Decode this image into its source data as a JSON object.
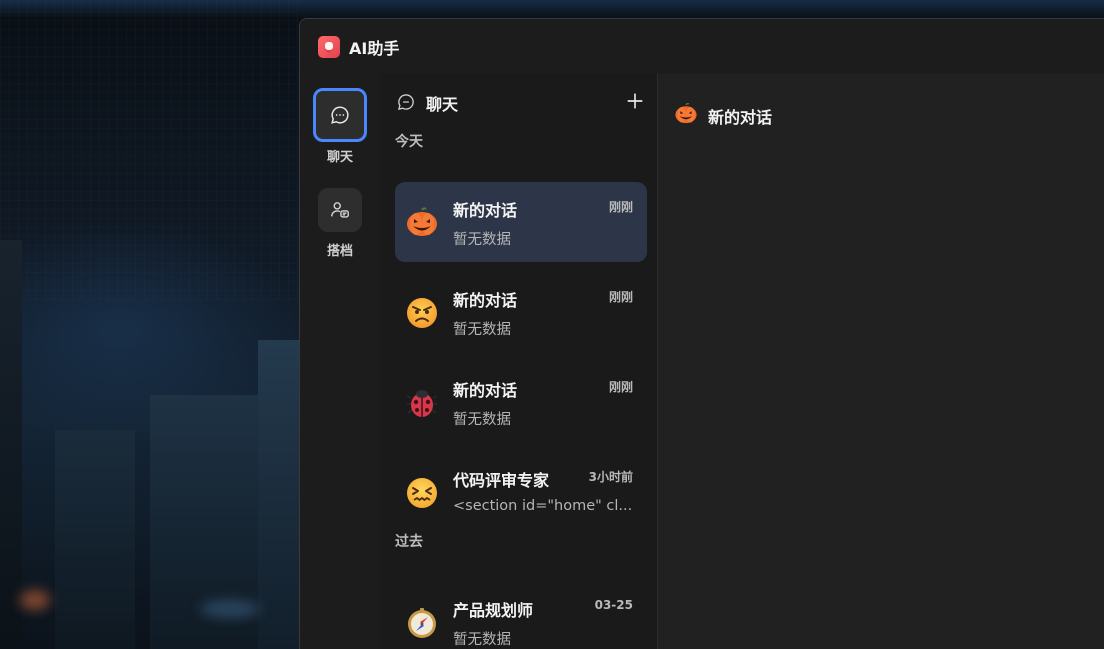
{
  "app": {
    "title": "AI助手",
    "brand_color": "#e0424d",
    "accent_color": "#4a87ff"
  },
  "rail": {
    "items": [
      {
        "label": "聊天",
        "icon": "chat-bubble-icon",
        "active": true
      },
      {
        "label": "搭档",
        "icon": "partner-icon",
        "active": false
      }
    ]
  },
  "sessions": {
    "header_title": "聊天",
    "header_icon": "chat-bubble-icon",
    "new_button_icon": "plus-icon",
    "groups": [
      {
        "label": "今天"
      },
      {
        "label": "过去"
      }
    ],
    "items": [
      {
        "title": "新的对话",
        "time": "刚刚",
        "preview": "暂无数据",
        "emoji": "pumpkin-icon",
        "selected": true
      },
      {
        "title": "新的对话",
        "time": "刚刚",
        "preview": "暂无数据",
        "emoji": "angry-face-icon",
        "selected": false
      },
      {
        "title": "新的对话",
        "time": "刚刚",
        "preview": "暂无数据",
        "emoji": "ladybug-icon",
        "selected": false
      },
      {
        "title": "代码评审专家",
        "time": "3小时前",
        "preview": "<section id=\"home\" cl...",
        "emoji": "confounded-face-icon",
        "selected": false
      },
      {
        "title": "产品规划师",
        "time": "03-25",
        "preview": "暂无数据",
        "emoji": "compass-icon",
        "selected": false
      }
    ]
  },
  "main": {
    "title": "新的对话",
    "emoji": "pumpkin-icon"
  }
}
